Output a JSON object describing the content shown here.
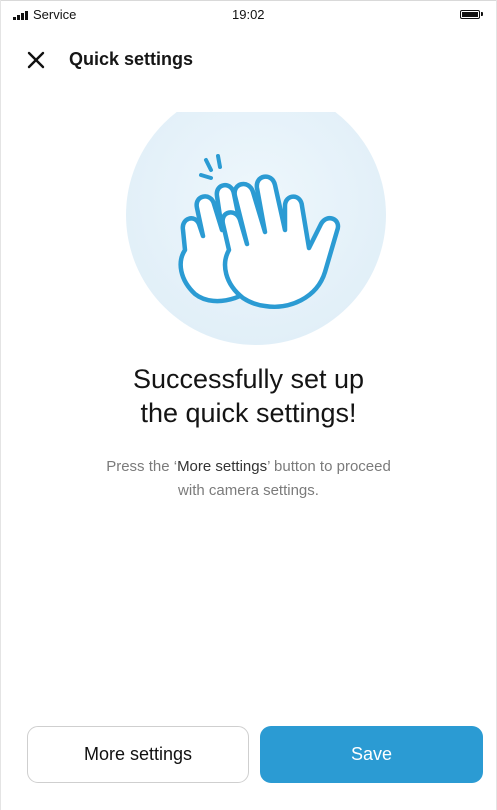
{
  "status_bar": {
    "carrier": "Service",
    "time": "19:02"
  },
  "header": {
    "title": "Quick settings",
    "close_icon": "close-icon"
  },
  "illustration": {
    "icon": "clapping-hands-icon"
  },
  "message": {
    "headline_line1": "Successfully set up",
    "headline_line2": "the quick settings!",
    "sub_prefix": "Press the ‘",
    "sub_highlight": "More settings",
    "sub_suffix": "’ button to proceed",
    "sub_line2": "with camera settings."
  },
  "actions": {
    "more_settings_label": "More settings",
    "save_label": "Save"
  },
  "colors": {
    "accent": "#2b9bd3",
    "illustration_bg": "#e6f2fa",
    "text_primary": "#141414",
    "text_secondary": "#7b7b7b"
  }
}
